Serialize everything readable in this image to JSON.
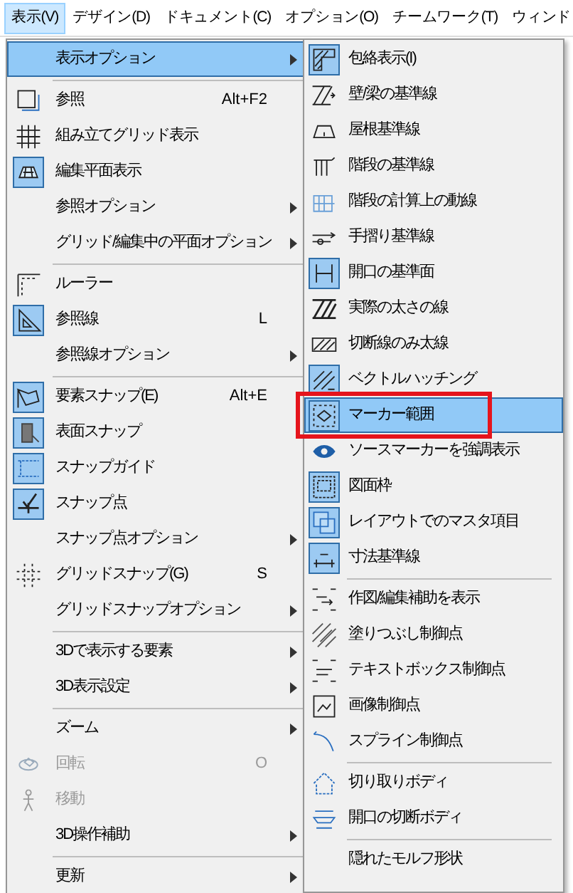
{
  "menu_bar": [
    {
      "label": "表示(V)",
      "selected": true
    },
    {
      "label": "デザイン(D)",
      "selected": false
    },
    {
      "label": "ドキュメント(C)",
      "selected": false
    },
    {
      "label": "オプション(O)",
      "selected": false
    },
    {
      "label": "チームワーク(T)",
      "selected": false
    },
    {
      "label": "ウィンド",
      "selected": false
    }
  ],
  "view_menu": {
    "items": [
      {
        "kind": "item",
        "label": "表示オプション",
        "submenu": true,
        "checked": false,
        "selected": true,
        "disabled": false
      },
      {
        "kind": "separator"
      },
      {
        "kind": "item",
        "label": "参照",
        "shortcut": "Alt+F2",
        "checked": false,
        "selected": false,
        "disabled": false
      },
      {
        "kind": "item",
        "label": "組み立てグリッド表示",
        "checked": false,
        "selected": false,
        "disabled": false
      },
      {
        "kind": "item",
        "label": "編集平面表示",
        "checked": true,
        "selected": false,
        "disabled": false
      },
      {
        "kind": "item",
        "label": "参照オプション",
        "submenu": true,
        "checked": false,
        "selected": false,
        "disabled": false
      },
      {
        "kind": "item",
        "label": "グリッド/編集中の平面オプション",
        "submenu": true,
        "checked": false,
        "selected": false,
        "disabled": false
      },
      {
        "kind": "separator"
      },
      {
        "kind": "item",
        "label": "ルーラー",
        "checked": false,
        "selected": false,
        "disabled": false
      },
      {
        "kind": "item",
        "label": "参照線",
        "shortcut": "L",
        "checked": true,
        "selected": false,
        "disabled": false
      },
      {
        "kind": "item",
        "label": "参照線オプション",
        "submenu": true,
        "checked": false,
        "selected": false,
        "disabled": false
      },
      {
        "kind": "separator"
      },
      {
        "kind": "item",
        "label": "要素スナップ(E)",
        "shortcut": "Alt+E",
        "checked": true,
        "selected": false,
        "disabled": false
      },
      {
        "kind": "item",
        "label": "表面スナップ",
        "checked": true,
        "selected": false,
        "disabled": false
      },
      {
        "kind": "item",
        "label": "スナップガイド",
        "checked": true,
        "selected": false,
        "disabled": false
      },
      {
        "kind": "item",
        "label": "スナップ点",
        "checked": true,
        "selected": false,
        "disabled": false
      },
      {
        "kind": "item",
        "label": "スナップ点オプション",
        "submenu": true,
        "checked": false,
        "selected": false,
        "disabled": false
      },
      {
        "kind": "item",
        "label": "グリッドスナップ(G)",
        "shortcut": "S",
        "checked": false,
        "selected": false,
        "disabled": false
      },
      {
        "kind": "item",
        "label": "グリッドスナップオプション",
        "submenu": true,
        "checked": false,
        "selected": false,
        "disabled": false
      },
      {
        "kind": "separator"
      },
      {
        "kind": "item",
        "label": "3Dで表示する要素",
        "submenu": true,
        "checked": false,
        "selected": false,
        "disabled": false
      },
      {
        "kind": "item",
        "label": "3D表示設定",
        "submenu": true,
        "checked": false,
        "selected": false,
        "disabled": false
      },
      {
        "kind": "separator"
      },
      {
        "kind": "item",
        "label": "ズーム",
        "submenu": true,
        "checked": false,
        "selected": false,
        "disabled": false
      },
      {
        "kind": "item",
        "label": "回転",
        "shortcut": "O",
        "checked": false,
        "selected": false,
        "disabled": true
      },
      {
        "kind": "item",
        "label": "移動",
        "checked": false,
        "selected": false,
        "disabled": true
      },
      {
        "kind": "item",
        "label": "3D操作補助",
        "submenu": true,
        "checked": false,
        "selected": false,
        "disabled": false
      },
      {
        "kind": "separator"
      },
      {
        "kind": "item",
        "label": "更新",
        "submenu": true,
        "checked": false,
        "selected": false,
        "disabled": false
      }
    ]
  },
  "display_options_submenu": {
    "items": [
      {
        "kind": "item",
        "label": "包絡表示(I)",
        "checked": true,
        "selected": false,
        "highlighted": false
      },
      {
        "kind": "item",
        "label": "壁/梁の基準線",
        "checked": false,
        "selected": false,
        "highlighted": false
      },
      {
        "kind": "item",
        "label": "屋根基準線",
        "checked": false,
        "selected": false,
        "highlighted": false
      },
      {
        "kind": "item",
        "label": "階段の基準線",
        "checked": false,
        "selected": false,
        "highlighted": false
      },
      {
        "kind": "item",
        "label": "階段の計算上の動線",
        "checked": false,
        "selected": false,
        "highlighted": false
      },
      {
        "kind": "item",
        "label": "手摺り基準線",
        "checked": false,
        "selected": false,
        "highlighted": false
      },
      {
        "kind": "item",
        "label": "開口の基準面",
        "checked": true,
        "selected": false,
        "highlighted": false
      },
      {
        "kind": "item",
        "label": "実際の太さの線",
        "checked": false,
        "selected": false,
        "highlighted": false
      },
      {
        "kind": "item",
        "label": "切断線のみ太線",
        "checked": false,
        "selected": false,
        "highlighted": false
      },
      {
        "kind": "item",
        "label": "ベクトルハッチング",
        "checked": true,
        "selected": false,
        "highlighted": false
      },
      {
        "kind": "item",
        "label": "マーカー範囲",
        "checked": true,
        "selected": true,
        "highlighted": true
      },
      {
        "kind": "item",
        "label": "ソースマーカーを強調表示",
        "checked": false,
        "selected": false,
        "highlighted": false
      },
      {
        "kind": "item",
        "label": "図面枠",
        "checked": true,
        "selected": false,
        "highlighted": false
      },
      {
        "kind": "item",
        "label": "レイアウトでのマスタ項目",
        "checked": true,
        "selected": false,
        "highlighted": false
      },
      {
        "kind": "item",
        "label": "寸法基準線",
        "checked": true,
        "selected": false,
        "highlighted": false
      },
      {
        "kind": "separator"
      },
      {
        "kind": "item",
        "label": "作図/編集補助を表示",
        "checked": false,
        "selected": false,
        "highlighted": false
      },
      {
        "kind": "item",
        "label": "塗りつぶし制御点",
        "checked": false,
        "selected": false,
        "highlighted": false
      },
      {
        "kind": "item",
        "label": "テキストボックス制御点",
        "checked": false,
        "selected": false,
        "highlighted": false
      },
      {
        "kind": "item",
        "label": "画像制御点",
        "checked": false,
        "selected": false,
        "highlighted": false
      },
      {
        "kind": "item",
        "label": "スプライン制御点",
        "checked": false,
        "selected": false,
        "highlighted": false
      },
      {
        "kind": "separator"
      },
      {
        "kind": "item",
        "label": "切り取りボディ",
        "checked": false,
        "selected": false,
        "highlighted": false
      },
      {
        "kind": "item",
        "label": "開口の切断ボディ",
        "checked": false,
        "selected": false,
        "highlighted": false
      },
      {
        "kind": "separator"
      },
      {
        "kind": "item",
        "label": "隠れたモルフ形状",
        "checked": false,
        "selected": false,
        "highlighted": false
      }
    ]
  }
}
